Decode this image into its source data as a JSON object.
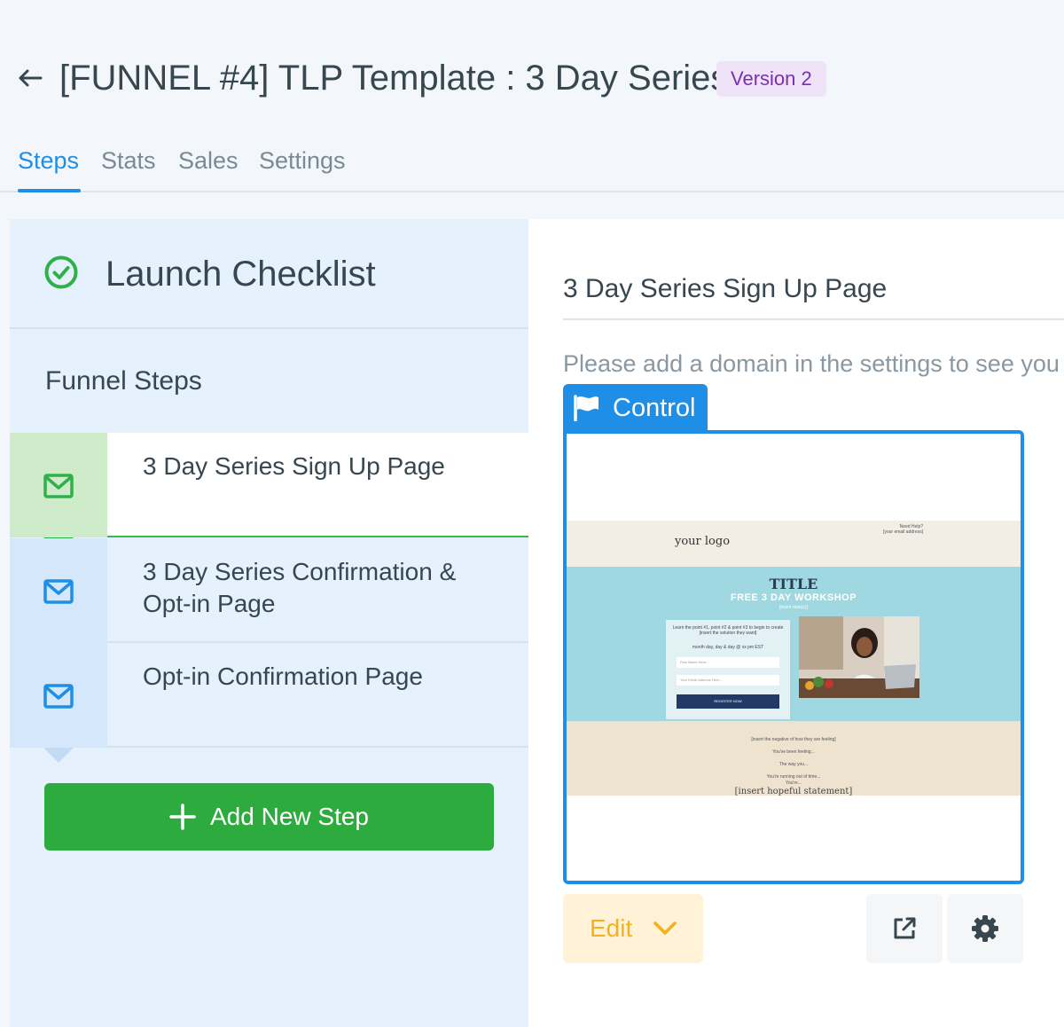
{
  "header": {
    "title": "[FUNNEL #4] TLP Template : 3 Day Series",
    "version_badge": "Version 2",
    "back_icon": "arrow-left-icon"
  },
  "tabs": [
    {
      "label": "Steps",
      "active": true
    },
    {
      "label": "Stats",
      "active": false
    },
    {
      "label": "Sales",
      "active": false
    },
    {
      "label": "Settings",
      "active": false
    }
  ],
  "sidebar": {
    "checklist_title": "Launch Checklist",
    "funnel_steps_title": "Funnel Steps",
    "steps": [
      {
        "label": "3 Day Series Sign Up Page",
        "icon": "envelope-icon",
        "active": true
      },
      {
        "label": "3 Day Series Confirmation & Opt-in Page",
        "icon": "envelope-icon",
        "active": false
      },
      {
        "label": "Opt-in Confirmation Page",
        "icon": "envelope-icon",
        "active": false
      }
    ],
    "add_step_label": "Add New Step"
  },
  "main": {
    "title": "3 Day Series Sign Up Page",
    "domain_notice": "Please add a domain in the settings to see you",
    "control_label": "Control",
    "edit_label": "Edit",
    "preview": {
      "logo": "your logo",
      "help_title": "Need Help?",
      "help_subtitle": "[your email address]",
      "title": "TITLE",
      "subtitle": "FREE 3 DAY WORKSHOP",
      "dates": "[insert date(s)]",
      "form_text": "Learn the point #1, point #2 & point #3 to begin to create [insert the solution they want]",
      "form_time": "month day, day & day @ xx pm EST",
      "name_placeholder": "First Name Here...",
      "email_placeholder": "Your Email Address Here...",
      "register_label": "REGISTER NOW",
      "lines": [
        "[insert the negative of how they are feeling]",
        "You've been feeling...",
        "The way you...",
        "You're running out of time...",
        "You're..."
      ],
      "statement": "[insert hopeful statement]"
    }
  },
  "colors": {
    "accent": "#1e8ee6",
    "success": "#2dab3e",
    "badge_bg": "#efe3f8",
    "badge_text": "#7b2fb0",
    "edit_bg": "#fff2d6",
    "edit_text": "#f2b21e"
  }
}
